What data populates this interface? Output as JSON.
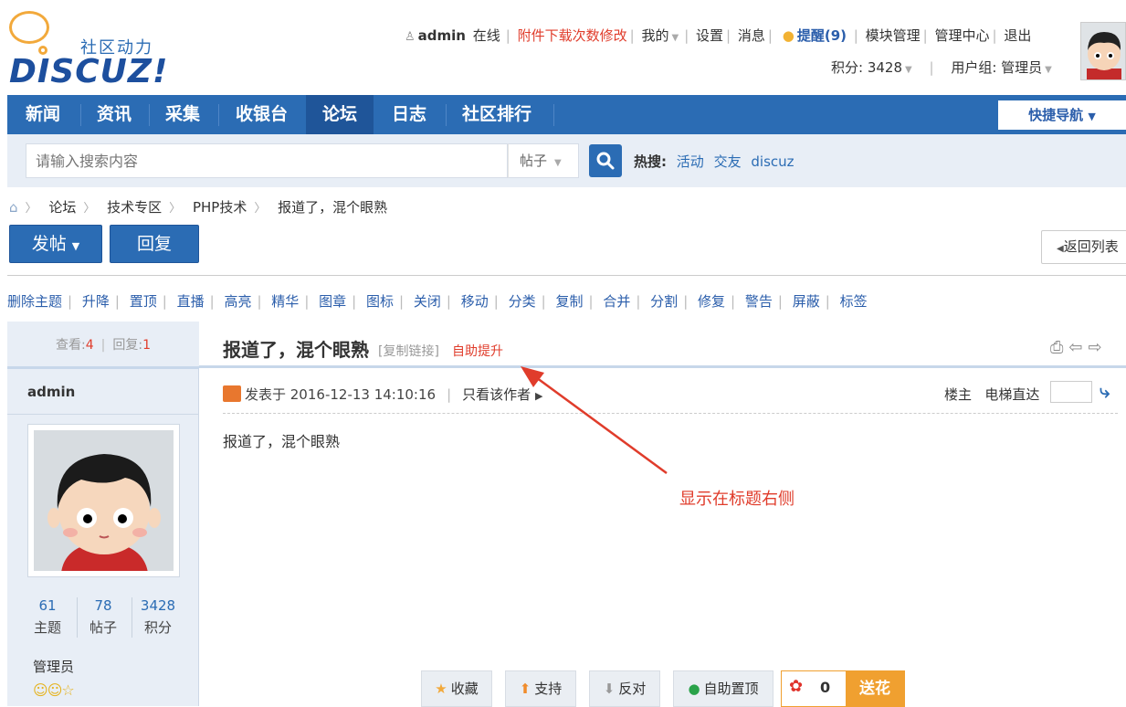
{
  "logo": {
    "subtitle": "社区动力",
    "brand": "DISCUZ!"
  },
  "topbar": {
    "username": "admin",
    "online": "在线",
    "attach_link": "附件下载次数修改",
    "my": "我的",
    "settings": "设置",
    "messages": "消息",
    "reminder": "提醒(9)",
    "module_manage": "模块管理",
    "admin_center": "管理中心",
    "logout": "退出",
    "points": "积分: 3428",
    "usergroup": "用户组: 管理员"
  },
  "nav": {
    "items": [
      "新闻",
      "资讯",
      "采集",
      "收银台",
      "论坛",
      "日志",
      "社区排行"
    ],
    "active": "论坛",
    "quicknav": "快捷导航"
  },
  "search": {
    "placeholder": "请输入搜索内容",
    "type": "帖子",
    "hot_label": "热搜:",
    "hot_keywords": [
      "活动",
      "交友",
      "discuz"
    ]
  },
  "breadcrumb": [
    "论坛",
    "技术专区",
    "PHP技术",
    "报道了，混个眼熟"
  ],
  "actions": {
    "new_post": "发帖",
    "reply": "回复",
    "back_to_list": "返回列表"
  },
  "mod_tools": [
    "删除主题",
    "升降",
    "置顶",
    "直播",
    "高亮",
    "精华",
    "图章",
    "图标",
    "关闭",
    "移动",
    "分类",
    "复制",
    "合并",
    "分割",
    "修复",
    "警告",
    "屏蔽",
    "标签"
  ],
  "thread": {
    "views_label": "查看:",
    "views": "4",
    "replies_label": "回复:",
    "replies": "1",
    "title": "报道了，混个眼熟",
    "copy_link": "[复制链接]",
    "self_promote": "自助提升"
  },
  "author": {
    "name": "admin",
    "topics": "61",
    "topics_label": "主题",
    "posts": "78",
    "posts_label": "帖子",
    "points": "3428",
    "points_label": "积分",
    "group": "管理员"
  },
  "post": {
    "posted_at": "发表于 2016-12-13 14:10:16",
    "only_author": "只看该作者",
    "floor": "楼主",
    "jump_label": "电梯直达",
    "body": "报道了，混个眼熟"
  },
  "annotation": "显示在标题右侧",
  "bottom_buttons": {
    "favorite": "收藏",
    "support": "支持",
    "oppose": "反对",
    "self_pin": "自助置顶",
    "flower_count": "0",
    "send_flower": "送花"
  }
}
